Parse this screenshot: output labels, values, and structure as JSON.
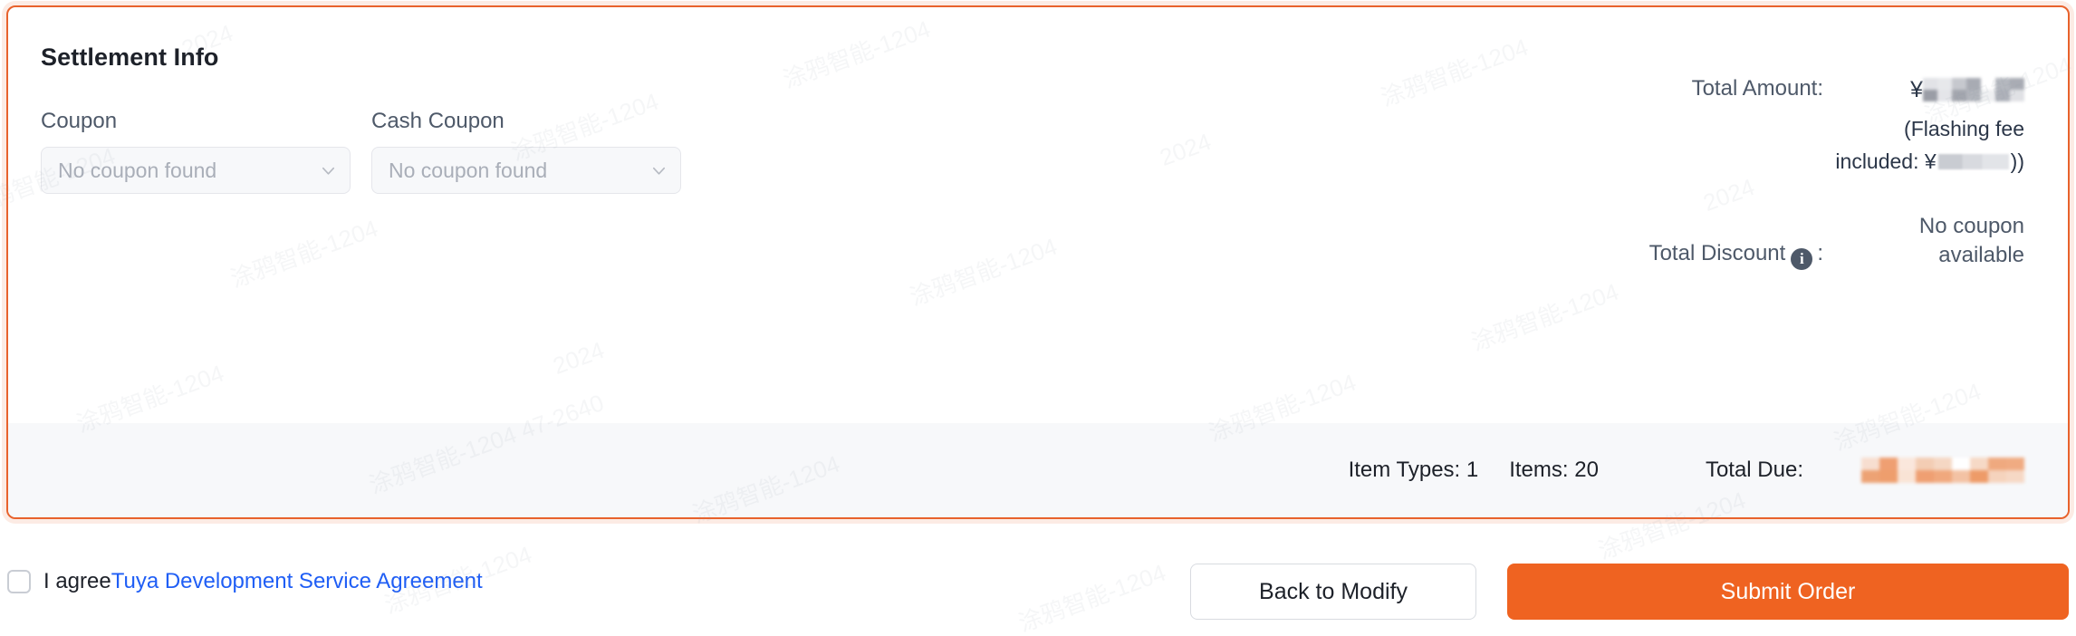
{
  "card": {
    "title": "Settlement Info",
    "border_color": "#e8622c"
  },
  "coupon_field": {
    "label": "Coupon",
    "value": "No coupon found",
    "chevron_icon": "chevron-down-icon"
  },
  "cash_coupon_field": {
    "label": "Cash Coupon",
    "value": "No coupon found",
    "chevron_icon": "chevron-down-icon"
  },
  "totals": {
    "total_amount_label": "Total Amount:",
    "total_amount_value": "¥",
    "total_amount_redacted": true,
    "flashing_fee_line1": "(Flashing fee",
    "flashing_fee_line2_prefix": "included: ¥",
    "flashing_fee_line2_suffix": "))",
    "flashing_fee_redacted": true,
    "total_discount_label": "Total Discount",
    "total_discount_colon": ":",
    "total_discount_info_icon": "info-circle-icon",
    "total_discount_value": "No coupon available"
  },
  "summary": {
    "item_types": "Item Types: 1",
    "items": "Items: 20",
    "total_due_label": "Total Due:",
    "total_due_redacted": true,
    "bar_background": "#f7f8fa"
  },
  "agreement": {
    "checkbox_checked": false,
    "agree_text": "I agree",
    "link_text": "Tuya Development Service Agreement",
    "link_color": "#1f5ef5"
  },
  "actions": {
    "back_label": "Back to Modify",
    "submit_label": "Submit Order",
    "submit_color": "#ef6321"
  },
  "watermark": {
    "text_a": "涂鸦智能-1204",
    "text_b": "2024",
    "text_c": "涂鸦智能-1204 47-2640"
  }
}
